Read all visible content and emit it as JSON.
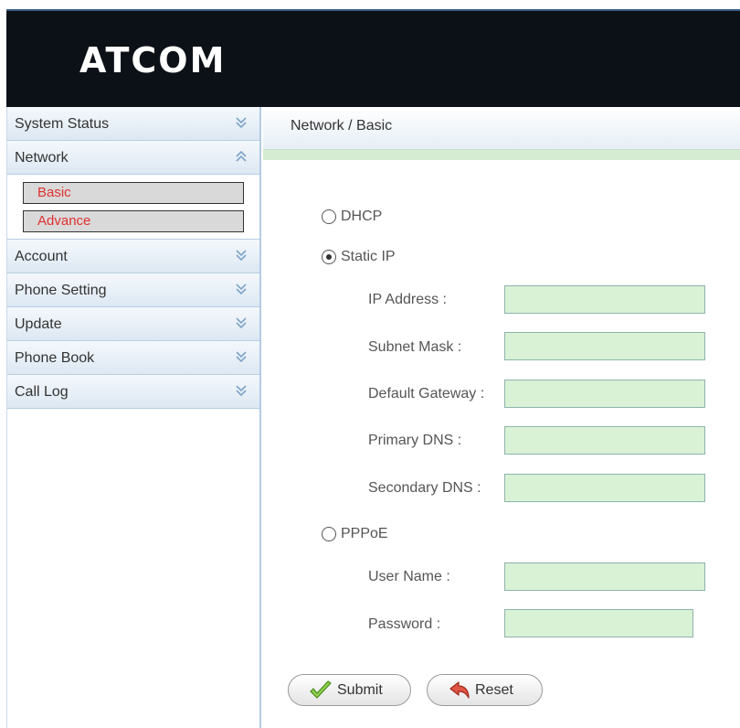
{
  "header": {
    "logo_text": "ATCOM"
  },
  "sidebar": {
    "items": [
      {
        "label": "System Status",
        "icon": "chevron-double-down-icon"
      },
      {
        "label": "Network",
        "icon": "chevron-double-up-icon"
      },
      {
        "label": "Account",
        "icon": "chevron-double-down-icon"
      },
      {
        "label": "Phone Setting",
        "icon": "chevron-double-down-icon"
      },
      {
        "label": "Update",
        "icon": "chevron-double-down-icon"
      },
      {
        "label": "Phone Book",
        "icon": "chevron-double-down-icon"
      },
      {
        "label": "Call Log",
        "icon": "chevron-double-down-icon"
      }
    ],
    "network_submenu": [
      {
        "label": "Basic"
      },
      {
        "label": "Advance"
      }
    ]
  },
  "main": {
    "breadcrumb": "Network / Basic",
    "modes": {
      "dhcp": {
        "label": "DHCP",
        "selected": false
      },
      "static_ip": {
        "label": "Static IP",
        "selected": true
      },
      "pppoe": {
        "label": "PPPoE",
        "selected": false
      }
    },
    "static_fields": {
      "ip_address": {
        "label": "IP Address :",
        "value": ""
      },
      "subnet_mask": {
        "label": "Subnet Mask :",
        "value": ""
      },
      "default_gateway": {
        "label": "Default Gateway :",
        "value": ""
      },
      "primary_dns": {
        "label": "Primary DNS :",
        "value": ""
      },
      "secondary_dns": {
        "label": "Secondary DNS :",
        "value": ""
      }
    },
    "pppoe_fields": {
      "user_name": {
        "label": "User Name :",
        "value": ""
      },
      "password": {
        "label": "Password :",
        "value": ""
      }
    },
    "buttons": {
      "submit": "Submit",
      "reset": "Reset"
    }
  },
  "colors": {
    "header_bg": "#0c1117",
    "field_bg": "#d9f2d6",
    "submenu_text": "#e0302f",
    "nav_border": "#b7cde3"
  }
}
